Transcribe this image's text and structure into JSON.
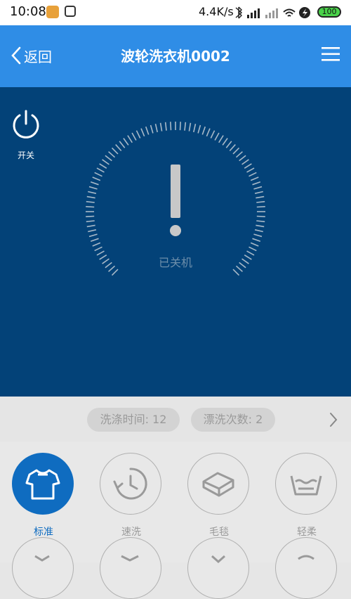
{
  "status_bar": {
    "time": "10:08",
    "network_speed": "4.4K/s",
    "battery": "100"
  },
  "header": {
    "back_label": "返回",
    "title": "波轮洗衣机0002"
  },
  "device": {
    "power_label": "开关",
    "state_text": "已关机"
  },
  "params": {
    "wash_time": "洗涤时间: 12",
    "rinse_count": "漂洗次数: 2"
  },
  "modes": [
    {
      "label": "标准",
      "icon": "tshirt-icon",
      "active": true
    },
    {
      "label": "速洗",
      "icon": "quick-clock-icon",
      "active": false
    },
    {
      "label": "毛毯",
      "icon": "blanket-icon",
      "active": false
    },
    {
      "label": "轻柔",
      "icon": "gentle-wash-icon",
      "active": false
    }
  ],
  "colors": {
    "header": "#2f8de6",
    "panel": "#034278",
    "active_mode": "#0f6cc0"
  }
}
